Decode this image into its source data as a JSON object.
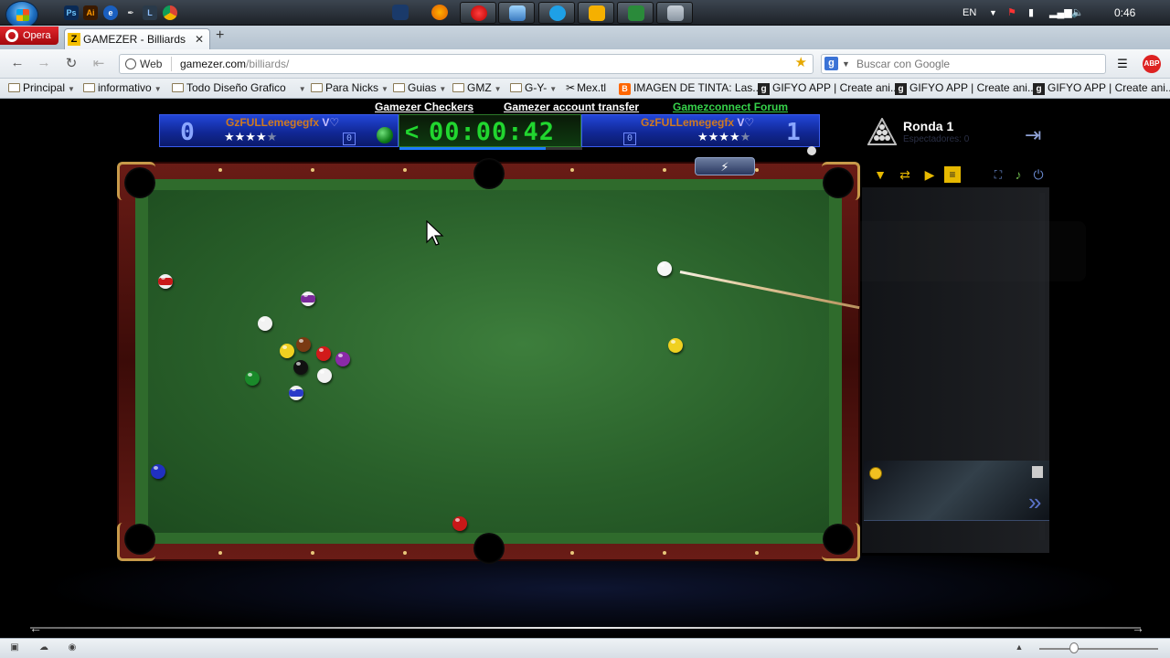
{
  "taskbar": {
    "language": "EN",
    "time": "0:46"
  },
  "browser": {
    "opera_label": "Opera",
    "tab_title": "GAMEZER - Billiards",
    "tab_favicon": "Z",
    "new_tab": "+",
    "address_prefix": "Web",
    "address_domain": "gamezer.com",
    "address_path": "/billiards/",
    "search_placeholder": "Buscar con Google",
    "search_engine_letter": "g",
    "bookmarks": [
      {
        "label": "Principal",
        "type": "folder"
      },
      {
        "label": "informativo",
        "type": "folder"
      },
      {
        "label": "Todo Diseño Grafico",
        "type": "folder"
      },
      {
        "label": "Para Nicks",
        "type": "folder"
      },
      {
        "label": "Guias",
        "type": "folder"
      },
      {
        "label": "GMZ",
        "type": "folder"
      },
      {
        "label": "G-Y-",
        "type": "folder"
      },
      {
        "label": "Mex.tl",
        "type": "link"
      },
      {
        "label": "IMAGEN DE TINTA: Las...",
        "type": "blogger"
      },
      {
        "label": "GIFYO APP | Create ani...",
        "type": "gifyo"
      },
      {
        "label": "GIFYO APP | Create ani...",
        "type": "gifyo"
      },
      {
        "label": "GIFYO APP | Create ani...",
        "type": "gifyo"
      }
    ]
  },
  "page": {
    "links": [
      "Gamezer Checkers",
      "Gamezer account transfer",
      "Gamezconnect Forum"
    ],
    "link_colors": [
      "#ffffff",
      "#ffffff",
      "#36d14a"
    ],
    "player1": {
      "score": "0",
      "name": "GzFULLemegegfx",
      "suffix": "V♡",
      "stars": "★★★★★",
      "filled_stars": 4,
      "mini": "0"
    },
    "player2": {
      "score": "1",
      "name": "GzFULLemegegfx",
      "suffix": "V♡",
      "stars": "★★★★★",
      "filled_stars": 4,
      "mini": "0"
    },
    "timer": "00:00:42",
    "timer_chevron": "<",
    "round_label": "Ronda 1",
    "spectators_label": "Espectadores: 0",
    "lightning": "⚡"
  },
  "colors": {
    "felt": "#3a7a38",
    "rail": "#5a1612",
    "hud_blue": "#1634b8",
    "timer_green": "#21d62f",
    "accent_gold": "#e6b800"
  },
  "icons": [
    "start-orb",
    "photoshop",
    "illustrator",
    "ie",
    "pen",
    "lightroom",
    "firefox",
    "opera",
    "hotspot",
    "skype",
    "media",
    "excel",
    "tool",
    "back",
    "forward",
    "reload",
    "home",
    "star",
    "menu",
    "adblock",
    "rack",
    "exit",
    "filter",
    "swap",
    "play",
    "list",
    "fullscreen",
    "sound",
    "power",
    "emoji",
    "trash",
    "send"
  ]
}
